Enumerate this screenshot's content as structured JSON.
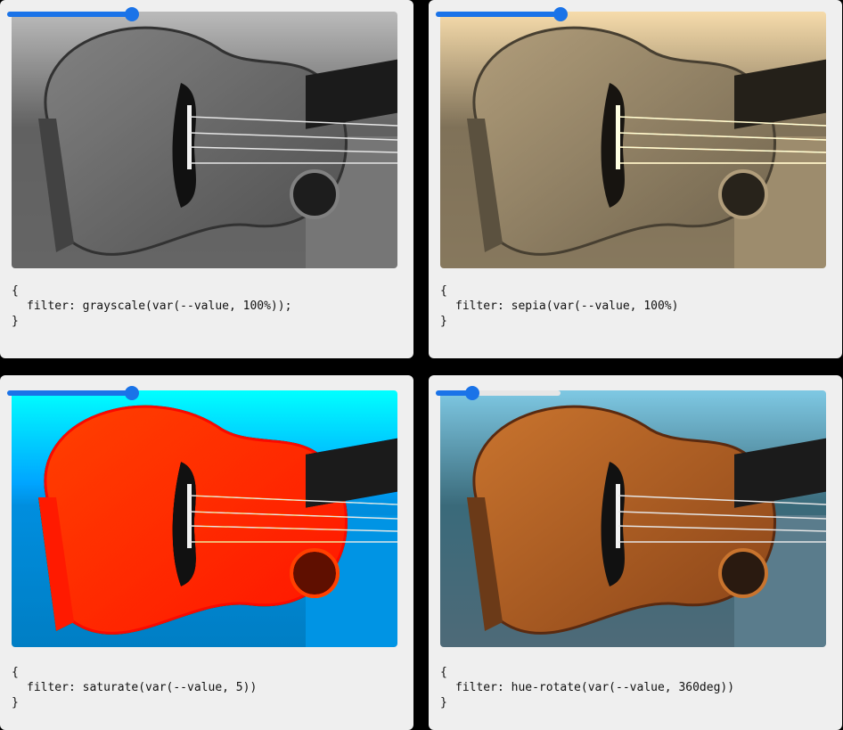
{
  "cards": [
    {
      "code_open": "{",
      "code_line": "filter: grayscale(var(--value, 100%));",
      "code_close": "}",
      "slider_value": 1.0
    },
    {
      "code_open": "{",
      "code_line": "filter: sepia(var(--value, 100%)",
      "code_close": "}",
      "slider_value": 1.0
    },
    {
      "code_open": "{",
      "code_line": "filter: saturate(var(--value, 5))",
      "code_close": "}",
      "slider_value": 1.0
    },
    {
      "code_open": "{",
      "code_line": "filter: hue-rotate(var(--value, 360deg))",
      "code_close": "}",
      "slider_value": 0.29
    }
  ],
  "colors": {
    "accent": "#1a73e8",
    "card_bg": "#efefef",
    "page_bg": "#000000"
  }
}
